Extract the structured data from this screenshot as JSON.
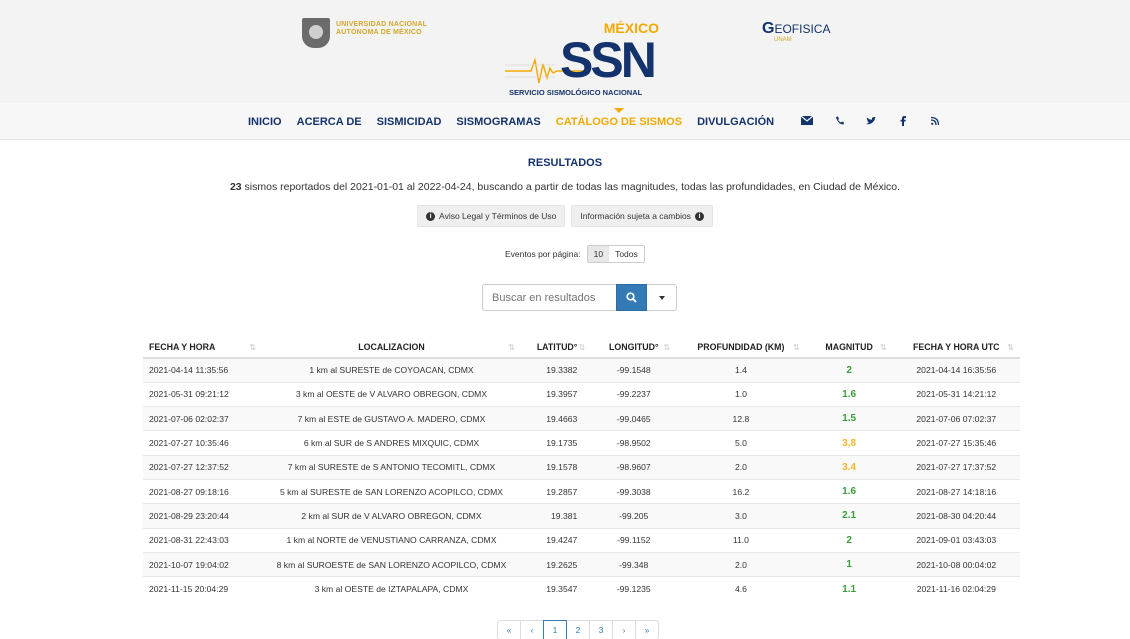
{
  "header": {
    "unam_text_line1": "UNIVERSIDAD NACIONAL",
    "unam_text_line2": "AUTÓNOMA DE MÉXICO",
    "ssn_country": "MÉXICO",
    "ssn_letters": "SSN",
    "ssn_subtitle": "SERVICIO SISMOLÓGICO NACIONAL",
    "geo_g": "G",
    "geo_rest": "EOFISICA",
    "geo_unam": "UNAM"
  },
  "nav": {
    "items": [
      "INICIO",
      "ACERCA DE",
      "SISMICIDAD",
      "SISMOGRAMAS",
      "CATÁLOGO DE SISMOS",
      "DIVULGACIÓN"
    ],
    "active_index": 4,
    "icons": [
      "envelope-icon",
      "phone-icon",
      "twitter-icon",
      "facebook-icon",
      "rss-icon"
    ]
  },
  "results": {
    "title": "RESULTADOS",
    "count": "23",
    "summary_rest": " sismos reportados del 2021-01-01 al 2022-04-24, buscando a partir de todas las magnitudes, todas las profundidades, en Ciudad de México.",
    "legal_label": "Aviso Legal y Términos de Uso",
    "changes_label": "Información sujeta a cambios",
    "per_page_label": "Eventos por página:",
    "per_page_options": [
      "10",
      "Todos"
    ],
    "search_placeholder": "Buscar en resultados"
  },
  "table": {
    "headers": [
      "FECHA Y HORA",
      "LOCALIZACION",
      "LATITUD°",
      "LONGITUD°",
      "PROFUNDIDAD (KM)",
      "MAGNITUD",
      "FECHA Y HORA UTC"
    ],
    "rows": [
      [
        "2021-04-14  11:35:56",
        "1 km al SURESTE de COYOACAN, CDMX",
        "19.3382",
        "-99.1548",
        "1.4",
        "2",
        "2021-04-14  16:35:56"
      ],
      [
        "2021-05-31  09:21:12",
        "3 km al OESTE de V ALVARO OBREGON, CDMX",
        "19.3957",
        "-99.2237",
        "1.0",
        "1.6",
        "2021-05-31  14:21:12"
      ],
      [
        "2021-07-06  02:02:37",
        "7 km al ESTE de GUSTAVO A. MADERO, CDMX",
        "19.4663",
        "-99.0465",
        "12.8",
        "1.5",
        "2021-07-06  07:02:37"
      ],
      [
        "2021-07-27  10:35:46",
        "6 km al SUR de S ANDRES MIXQUIC, CDMX",
        "19.1735",
        "-98.9502",
        "5.0",
        "3.8",
        "2021-07-27  15:35:46"
      ],
      [
        "2021-07-27  12:37:52",
        "7 km al SURESTE de S ANTONIO TECOMITL, CDMX",
        "19.1578",
        "-98.9607",
        "2.0",
        "3.4",
        "2021-07-27  17:37:52"
      ],
      [
        "2021-08-27  09:18:16",
        "5 km al SURESTE de SAN LORENZO ACOPILCO, CDMX",
        "19.2857",
        "-99.3038",
        "16.2",
        "1.6",
        "2021-08-27  14:18:16"
      ],
      [
        "2021-08-29  23:20:44",
        "2 km al SUR de V ALVARO OBREGON, CDMX",
        "19.381",
        "-99.205",
        "3.0",
        "2.1",
        "2021-08-30  04:20:44"
      ],
      [
        "2021-08-31  22:43:03",
        "1 km al NORTE de VENUSTIANO CARRANZA, CDMX",
        "19.4247",
        "-99.1152",
        "11.0",
        "2",
        "2021-09-01  03:43:03"
      ],
      [
        "2021-10-07  19:04:02",
        "8 km al SUROESTE de SAN LORENZO ACOPILCO, CDMX",
        "19.2625",
        "-99.348",
        "2.0",
        "1",
        "2021-10-08  00:04:02"
      ],
      [
        "2021-11-15  20:04:29",
        "3 km al OESTE de IZTAPALAPA, CDMX",
        "19.3547",
        "-99.1235",
        "4.6",
        "1.1",
        "2021-11-16  02:04:29"
      ]
    ],
    "mag_color_low": "#3a9d3a",
    "mag_color_mid": "#f0b428"
  },
  "pagination": {
    "pages": [
      "«",
      "‹",
      "1",
      "2",
      "3",
      "›",
      "»"
    ],
    "active": "1"
  },
  "colors": {
    "brand_navy": "#14326b",
    "accent_gold": "#f2a900",
    "link_blue": "#337ab7"
  }
}
